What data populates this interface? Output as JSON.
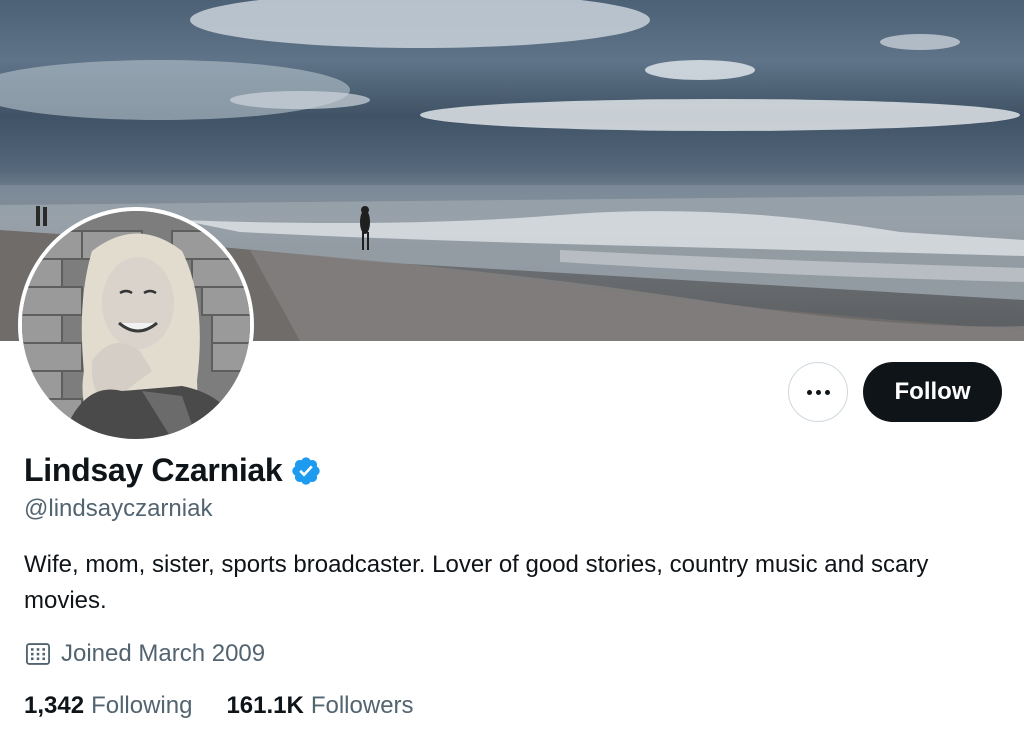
{
  "profile": {
    "display_name": "Lindsay Czarniak",
    "handle": "@lindsayczarniak",
    "bio": "Wife, mom, sister, sports broadcaster. Lover of good stories, country music and scary movies.",
    "joined": "Joined March 2009",
    "verified": true
  },
  "actions": {
    "follow_label": "Follow",
    "more_icon": "more-horizontal-icon"
  },
  "stats": {
    "following_count": "1,342",
    "following_label": "Following",
    "followers_count": "161.1K",
    "followers_label": "Followers"
  },
  "colors": {
    "primary_text": "#0f1419",
    "secondary_text": "#536471",
    "verified_badge": "#1d9bf0",
    "follow_button_bg": "#0f1419",
    "border": "#cfd9de"
  },
  "icons": {
    "verified": "verified-badge-icon",
    "calendar": "calendar-icon"
  }
}
